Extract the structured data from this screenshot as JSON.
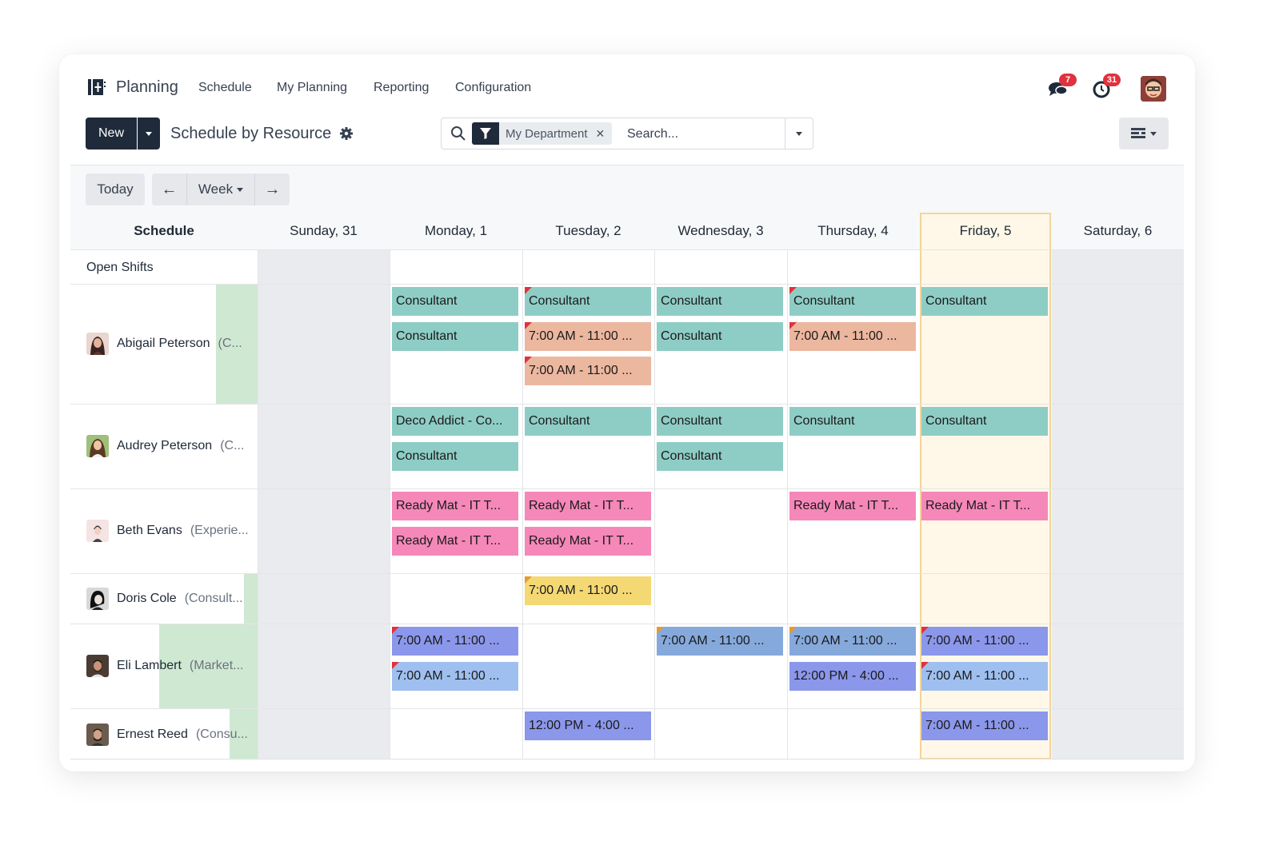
{
  "nav": {
    "app_name": "Planning",
    "items": [
      "Schedule",
      "My Planning",
      "Reporting",
      "Configuration"
    ],
    "messages_count": "7",
    "activities_count": "31"
  },
  "toolbar": {
    "new_label": "New",
    "view_title": "Schedule by Resource",
    "filter_facet": "My Department",
    "search_placeholder": "Search..."
  },
  "gantt": {
    "today_label": "Today",
    "scale_label": "Week",
    "prev_icon": "arrow-left-icon",
    "next_icon": "arrow-right-icon",
    "schedule_header": "Schedule",
    "days": [
      "Sunday, 31",
      "Monday, 1",
      "Tuesday, 2",
      "Wednesday, 3",
      "Thursday, 4",
      "Friday, 5",
      "Saturday, 6"
    ],
    "open_shifts_label": "Open Shifts",
    "resources": [
      {
        "name": "Abigail Peterson",
        "role": "(C..."
      },
      {
        "name": "Audrey Peterson",
        "role": "(C..."
      },
      {
        "name": "Beth Evans",
        "role": "(Experie..."
      },
      {
        "name": "Doris Cole",
        "role": "(Consult..."
      },
      {
        "name": "Eli Lambert",
        "role": "(Market..."
      },
      {
        "name": "Ernest Reed",
        "role": "(Consu..."
      }
    ],
    "shifts": [
      {
        "row": 0,
        "day": 1,
        "slot": 0,
        "label": "Consultant",
        "color": "#8ecdc5"
      },
      {
        "row": 0,
        "day": 1,
        "slot": 1,
        "label": "Consultant",
        "color": "#8ecdc5"
      },
      {
        "row": 0,
        "day": 2,
        "slot": 0,
        "label": "Consultant",
        "color": "#8ecdc5",
        "flag": "#e0323c"
      },
      {
        "row": 0,
        "day": 2,
        "slot": 1,
        "label": "7:00 AM - 11:00 ...",
        "color": "#ecb79f",
        "flag": "#e0323c"
      },
      {
        "row": 0,
        "day": 2,
        "slot": 2,
        "label": "7:00 AM - 11:00 ...",
        "color": "#ecb79f",
        "flag": "#e0323c"
      },
      {
        "row": 0,
        "day": 3,
        "slot": 0,
        "label": "Consultant",
        "color": "#8ecdc5"
      },
      {
        "row": 0,
        "day": 3,
        "slot": 1,
        "label": "Consultant",
        "color": "#8ecdc5"
      },
      {
        "row": 0,
        "day": 4,
        "slot": 0,
        "label": "Consultant",
        "color": "#8ecdc5",
        "flag": "#e0323c"
      },
      {
        "row": 0,
        "day": 4,
        "slot": 1,
        "label": "7:00 AM - 11:00 ...",
        "color": "#ecb79f",
        "flag": "#e0323c"
      },
      {
        "row": 0,
        "day": 5,
        "slot": 0,
        "label": "Consultant",
        "color": "#8ecdc5"
      },
      {
        "row": 1,
        "day": 1,
        "slot": 0,
        "label": "Deco Addict - Co...",
        "color": "#8ecdc5"
      },
      {
        "row": 1,
        "day": 1,
        "slot": 1,
        "label": "Consultant",
        "color": "#8ecdc5"
      },
      {
        "row": 1,
        "day": 2,
        "slot": 0,
        "label": "Consultant",
        "color": "#8ecdc5"
      },
      {
        "row": 1,
        "day": 3,
        "slot": 0,
        "label": "Consultant",
        "color": "#8ecdc5"
      },
      {
        "row": 1,
        "day": 3,
        "slot": 1,
        "label": "Consultant",
        "color": "#8ecdc5"
      },
      {
        "row": 1,
        "day": 4,
        "slot": 0,
        "label": "Consultant",
        "color": "#8ecdc5"
      },
      {
        "row": 1,
        "day": 5,
        "slot": 0,
        "label": "Consultant",
        "color": "#8ecdc5"
      },
      {
        "row": 2,
        "day": 1,
        "slot": 0,
        "label": "Ready Mat - IT T...",
        "color": "#f588b9"
      },
      {
        "row": 2,
        "day": 1,
        "slot": 1,
        "label": "Ready Mat - IT T...",
        "color": "#f588b9"
      },
      {
        "row": 2,
        "day": 2,
        "slot": 0,
        "label": "Ready Mat - IT T...",
        "color": "#f588b9"
      },
      {
        "row": 2,
        "day": 2,
        "slot": 1,
        "label": "Ready Mat - IT T...",
        "color": "#f588b9"
      },
      {
        "row": 2,
        "day": 4,
        "slot": 0,
        "label": "Ready Mat - IT T...",
        "color": "#f588b9"
      },
      {
        "row": 2,
        "day": 5,
        "slot": 0,
        "label": "Ready Mat - IT T...",
        "color": "#f588b9"
      },
      {
        "row": 3,
        "day": 2,
        "slot": 0,
        "label": "7:00 AM - 11:00 ...",
        "color": "#f4d873",
        "flag": "#e79a2a"
      },
      {
        "row": 4,
        "day": 1,
        "slot": 0,
        "label": "7:00 AM - 11:00 ...",
        "color": "#8b97ea",
        "flag": "#e0323c"
      },
      {
        "row": 4,
        "day": 1,
        "slot": 1,
        "label": "7:00 AM - 11:00 ...",
        "color": "#9ebfef",
        "flag": "#e0323c"
      },
      {
        "row": 4,
        "day": 3,
        "slot": 0,
        "label": "7:00 AM - 11:00 ...",
        "color": "#86a9dc",
        "flag": "#e79a2a"
      },
      {
        "row": 4,
        "day": 4,
        "slot": 0,
        "label": "7:00 AM - 11:00 ...",
        "color": "#86a9dc",
        "flag": "#e79a2a"
      },
      {
        "row": 4,
        "day": 4,
        "slot": 1,
        "label": "12:00 PM - 4:00 ...",
        "color": "#8b97ea"
      },
      {
        "row": 4,
        "day": 5,
        "slot": 0,
        "label": "7:00 AM - 11:00 ...",
        "color": "#8b97ea",
        "flag": "#e0323c"
      },
      {
        "row": 4,
        "day": 5,
        "slot": 1,
        "label": "7:00 AM - 11:00 ...",
        "color": "#9ebfef",
        "flag": "#e0323c"
      },
      {
        "row": 5,
        "day": 2,
        "slot": 0,
        "label": "12:00 PM - 4:00 ...",
        "color": "#8b97ea"
      },
      {
        "row": 5,
        "day": 5,
        "slot": 0,
        "label": "7:00 AM - 11:00 ...",
        "color": "#8b97ea"
      }
    ]
  }
}
